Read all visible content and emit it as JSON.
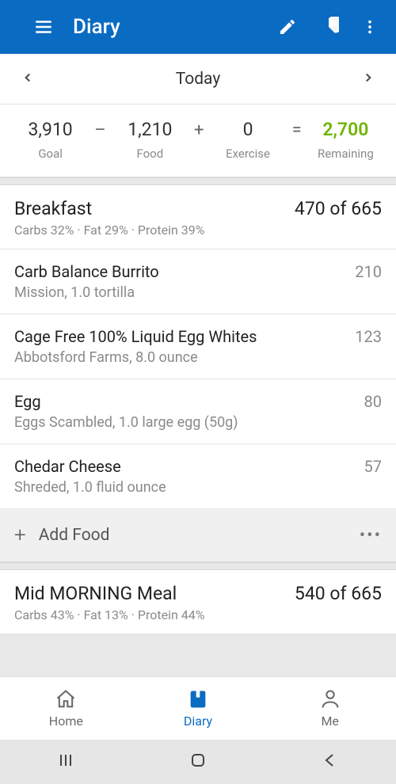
{
  "appbar": {
    "title": "Diary"
  },
  "dateNav": {
    "label": "Today"
  },
  "summary": {
    "goal": {
      "value": "3,910",
      "label": "Goal"
    },
    "food": {
      "value": "1,210",
      "label": "Food"
    },
    "exercise": {
      "value": "0",
      "label": "Exercise"
    },
    "remaining": {
      "value": "2,700",
      "label": "Remaining"
    },
    "ops": {
      "minus": "–",
      "plus": "+",
      "equals": "="
    }
  },
  "meals": [
    {
      "name": "Breakfast",
      "macros": "Carbs 32% · Fat 29% · Protein 39%",
      "totals": "470 of 665",
      "items": [
        {
          "name": "Carb Balance Burrito",
          "details": "Mission, 1.0 tortilla",
          "cals": "210"
        },
        {
          "name": "Cage Free 100% Liquid Egg Whites",
          "details": "Abbotsford Farms, 8.0 ounce",
          "cals": "123"
        },
        {
          "name": "Egg",
          "details": "Eggs Scambled, 1.0 large egg (50g)",
          "cals": "80"
        },
        {
          "name": "Chedar Cheese",
          "details": "Shreded, 1.0 fluid ounce",
          "cals": "57"
        }
      ],
      "addLabel": "Add Food"
    },
    {
      "name": "Mid MORNING Meal",
      "macros": "Carbs 43% · Fat 13% · Protein 44%",
      "totals": "540 of 665"
    }
  ],
  "tabs": {
    "home": "Home",
    "diary": "Diary",
    "me": "Me"
  }
}
